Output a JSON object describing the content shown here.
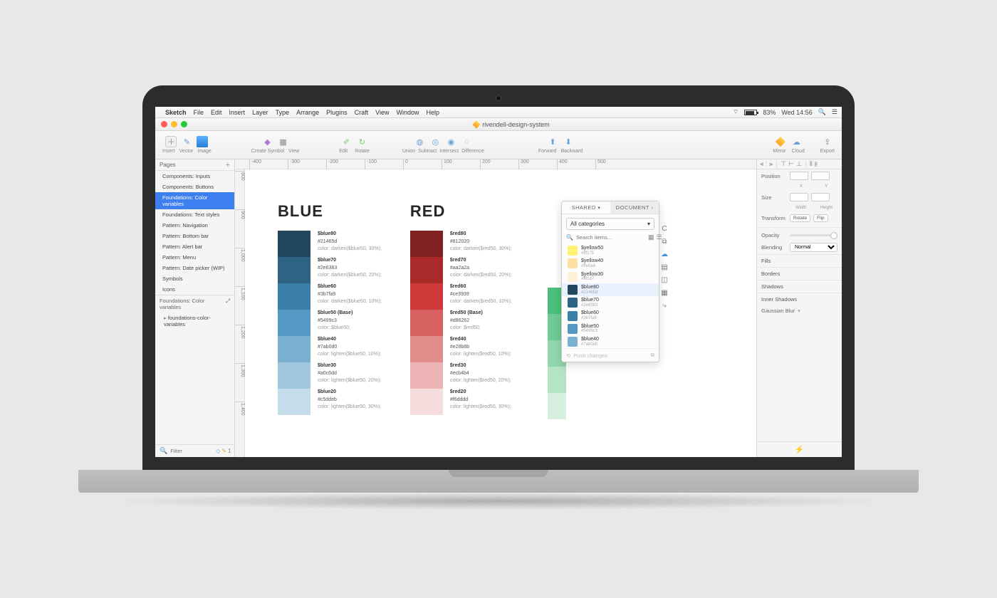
{
  "menubar": {
    "app": "Sketch",
    "items": [
      "File",
      "Edit",
      "Insert",
      "Layer",
      "Type",
      "Arrange",
      "Plugins",
      "Craft",
      "View",
      "Window",
      "Help"
    ],
    "battery": "83%",
    "clock": "Wed 14:56"
  },
  "window": {
    "title": "rivendell-design-system"
  },
  "toolbar": {
    "insert": "Insert",
    "vector": "Vector",
    "image": "Image",
    "create_symbol": "Create Symbol",
    "view": "View",
    "edit": "Edit",
    "rotate": "Rotate",
    "union": "Union",
    "subtract": "Subtract",
    "intersect": "Intersect",
    "difference": "Difference",
    "forward": "Forward",
    "backward": "Backward",
    "mirror": "Mirror",
    "cloud": "Cloud",
    "export": "Export"
  },
  "sidebar": {
    "header": "Pages",
    "pages": [
      "Components: Inputs",
      "Components: Buttons",
      "Foundations: Color variables",
      "Foundations: Text styles",
      "Pattern: Navigation",
      "Pattern: Bottom bar",
      "Pattern: Alert bar",
      "Pattern: Menu",
      "Pattern: Date picker (WIP)",
      "Symbols",
      "Icons"
    ],
    "selected_index": 2,
    "layer_header": "Foundations: Color variables",
    "layer_item": "foundations-color-variables",
    "filter_placeholder": "Filter",
    "filter_badge": "1"
  },
  "ruler_h": [
    "-400",
    "-300",
    "-200",
    "-100",
    "0",
    "100",
    "200",
    "300",
    "400",
    "500"
  ],
  "ruler_v": [
    "800",
    "900",
    "1,000",
    "1,100",
    "1,200",
    "1,300",
    "1,400"
  ],
  "canvas": {
    "blue": {
      "title": "BLUE",
      "rows": [
        {
          "name": "$blue80",
          "hex": "#21465d",
          "formula": "color: darken($blue50, 30%);",
          "swatch": "#21465d"
        },
        {
          "name": "$blue70",
          "hex": "#2e6383",
          "formula": "color: darken($blue50, 20%);",
          "swatch": "#2e6383"
        },
        {
          "name": "$blue60",
          "hex": "#3b7fa9",
          "formula": "color: darken($blue50, 10%);",
          "swatch": "#3b7fa9"
        },
        {
          "name": "$blue50 (Base)",
          "hex": "#5499c3",
          "formula": "color: $blue50;",
          "swatch": "#5499c3"
        },
        {
          "name": "$blue40",
          "hex": "#7ab0d0",
          "formula": "color: lighten($blue50, 10%);",
          "swatch": "#7ab0d0"
        },
        {
          "name": "$blue30",
          "hex": "#a0c6dd",
          "formula": "color: lighten($blue50, 20%);",
          "swatch": "#a0c6dd"
        },
        {
          "name": "$blue20",
          "hex": "#c5ddeb",
          "formula": "color: lighten($blue50, 30%);",
          "swatch": "#c5ddeb"
        }
      ]
    },
    "red": {
      "title": "RED",
      "rows": [
        {
          "name": "$red80",
          "hex": "#812020",
          "formula": "color: darken($red50, 30%);",
          "swatch": "#812020"
        },
        {
          "name": "$red70",
          "hex": "#aa2a2a",
          "formula": "color: darken($red50, 20%);",
          "swatch": "#aa2a2a"
        },
        {
          "name": "$red60",
          "hex": "#ce3939",
          "formula": "color: darken($red50, 10%);",
          "swatch": "#ce3939"
        },
        {
          "name": "$red50 (Base)",
          "hex": "#d86262",
          "formula": "color: $red50;",
          "swatch": "#d86262"
        },
        {
          "name": "$red40",
          "hex": "#e28b8b",
          "formula": "color: lighten($red50, 10%);",
          "swatch": "#e28b8b"
        },
        {
          "name": "$red30",
          "hex": "#ecb4b4",
          "formula": "color: lighten($red50, 20%);",
          "swatch": "#ecb4b4"
        },
        {
          "name": "$red20",
          "hex": "#f6dddd",
          "formula": "color: lighten($red50, 30%);",
          "swatch": "#f6dddd"
        }
      ]
    },
    "green_swatches": [
      "#4bbf7b",
      "#6ecb94",
      "#91d7ad",
      "#b4e3c6",
      "#d7efdf"
    ]
  },
  "popover": {
    "tabs": {
      "shared": "SHARED",
      "document": "DOCUMENT"
    },
    "category": "All categories",
    "search_placeholder": "Search items...",
    "items": [
      {
        "name": "$yellow50",
        "hex": "#fff175",
        "swatch": "#fff175"
      },
      {
        "name": "$yellow40",
        "hex": "#ffe0a4",
        "swatch": "#ffe0a4"
      },
      {
        "name": "$yellow30",
        "hex": "#fff1d7",
        "swatch": "#fff1d7"
      },
      {
        "name": "$blue80",
        "hex": "#21465d",
        "swatch": "#21465d"
      },
      {
        "name": "$blue70",
        "hex": "#2e6383",
        "swatch": "#2e6383"
      },
      {
        "name": "$blue60",
        "hex": "#3b7fa9",
        "swatch": "#3b7fa9"
      },
      {
        "name": "$blue50",
        "hex": "#5499c3",
        "swatch": "#5499c3"
      },
      {
        "name": "$blue40",
        "hex": "#7ab0d0",
        "swatch": "#7ab0d0"
      }
    ],
    "footer": "Push changes"
  },
  "inspector": {
    "position": "Position",
    "size": "Size",
    "transform": "Transform",
    "x": "X",
    "y": "Y",
    "width": "Width",
    "height": "Height",
    "rotate": "Rotate",
    "flip": "Flip",
    "opacity": "Opacity",
    "blending": "Blending",
    "blend_mode": "Normal",
    "fills": "Fills",
    "borders": "Borders",
    "shadows": "Shadows",
    "inner_shadows": "Inner Shadows",
    "gaussian": "Gaussian Blur"
  }
}
